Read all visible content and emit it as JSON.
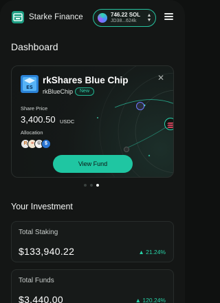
{
  "header": {
    "brand": "Starke Finance",
    "wallet": {
      "balance": "746.22 SOL",
      "address": "JD38...624k"
    }
  },
  "dashboard": {
    "title": "Dashboard"
  },
  "fund_card": {
    "name": "rkShares Blue Chip",
    "ticker": "rkBlueChip",
    "badge": "New",
    "share_price_label": "Share Price",
    "share_price": "3,400.50",
    "share_unit": "USDC",
    "allocation_label": "Allocation",
    "allocation_icons": [
      "rk-token-icon",
      "ribbon-token-icon",
      "rk-token-icon",
      "usdc-token-icon"
    ],
    "view_button": "View Fund",
    "accent": "#1fc6a2"
  },
  "carousel": {
    "total": 3,
    "active": 3
  },
  "investment": {
    "title": "Your Investment",
    "items": [
      {
        "label": "Total Staking",
        "value": "$133,940.22",
        "change": "▲ 21.24%"
      },
      {
        "label": "Total Funds",
        "value": "$3,440.00",
        "change": "▲ 120.24%"
      }
    ]
  }
}
